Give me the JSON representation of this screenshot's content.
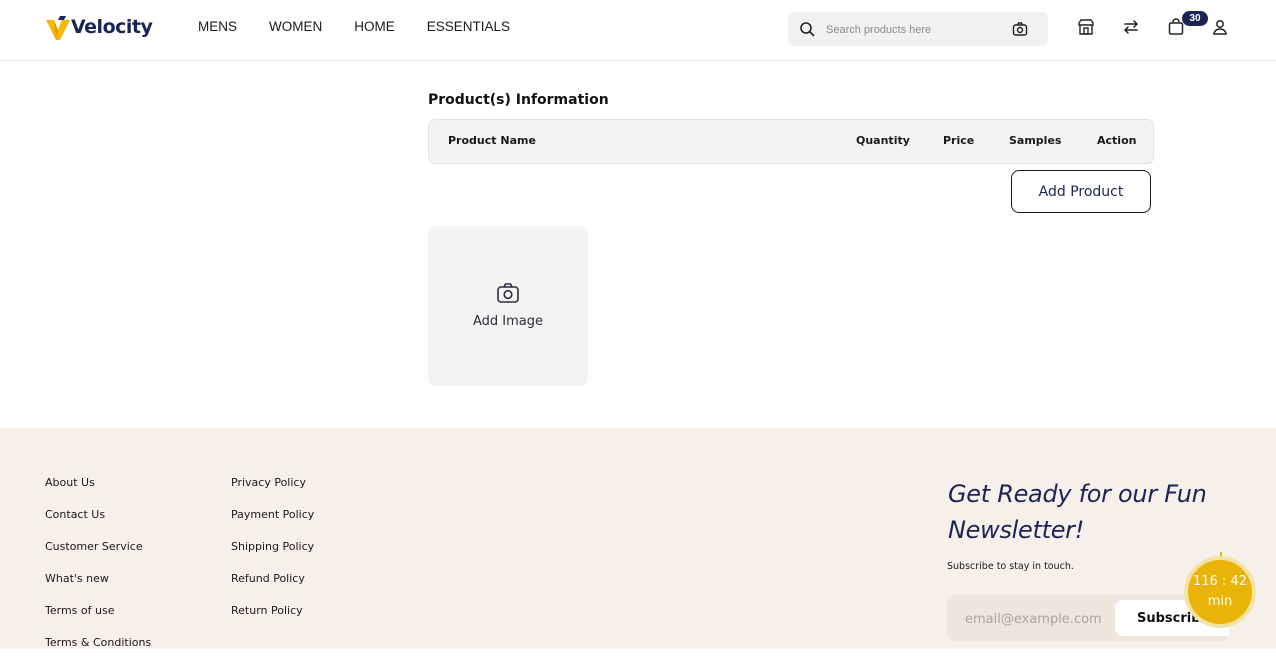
{
  "header": {
    "brand": "Velocity",
    "nav": [
      "MENS",
      "WOMEN",
      "HOME",
      "ESSENTIALS"
    ],
    "search_placeholder": "Search products here",
    "cart_count": "30",
    "icons": [
      "search-icon",
      "camera-icon",
      "store-icon",
      "swap-icon",
      "shopping-bag-icon",
      "user-icon"
    ]
  },
  "main": {
    "section_title": "Product(s) Information",
    "table_headers": {
      "product_name": "Product Name",
      "quantity": "Quantity",
      "price": "Price",
      "samples": "Samples",
      "action": "Action"
    },
    "add_product_label": "Add Product",
    "add_image_label": "Add Image"
  },
  "footer": {
    "col1": [
      "About Us",
      "Contact Us",
      "Customer Service",
      "What's new",
      "Terms of use",
      "Terms & Conditions"
    ],
    "col2": [
      "Privacy Policy",
      "Payment Policy",
      "Shipping Policy",
      "Refund Policy",
      "Return Policy"
    ],
    "newsletter_title": "Get Ready for our Fun Newsletter!",
    "newsletter_sub": "Subscribe to stay in touch.",
    "email_placeholder": "email@example.com",
    "subscribe_label": "Subscribe"
  },
  "timer": {
    "time": "116 : 42",
    "unit": "min"
  },
  "colors": {
    "brand_navy": "#1c2456",
    "brand_gold": "#eab308",
    "footer_bg": "#f5f0ea"
  }
}
